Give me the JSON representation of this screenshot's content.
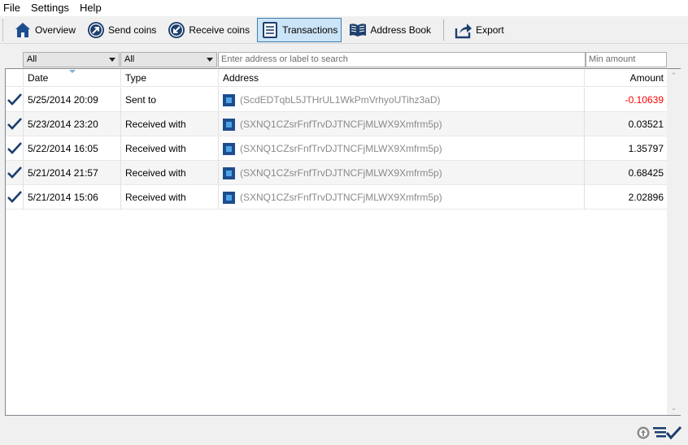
{
  "menu": [
    "File",
    "Settings",
    "Help"
  ],
  "toolbar": {
    "overview": "Overview",
    "send": "Send coins",
    "receive": "Receive coins",
    "transactions": "Transactions",
    "address_book": "Address Book",
    "export": "Export"
  },
  "filters": {
    "date_value": "All",
    "type_value": "All",
    "search_placeholder": "Enter address or label to search",
    "min_placeholder": "Min amount"
  },
  "table": {
    "headers": {
      "date": "Date",
      "type": "Type",
      "address": "Address",
      "amount": "Amount"
    },
    "rows": [
      {
        "date": "5/25/2014 20:09",
        "type": "Sent to",
        "address": "(ScdEDTqbL5JTHrUL1WkPmVrhyoUTihz3aD)",
        "amount": "-0.10639",
        "negative": true
      },
      {
        "date": "5/23/2014 23:20",
        "type": "Received with",
        "address": "(SXNQ1CZsrFnfTrvDJTNCFjMLWX9Xmfrm5p)",
        "amount": "0.03521",
        "negative": false
      },
      {
        "date": "5/22/2014 16:05",
        "type": "Received with",
        "address": "(SXNQ1CZsrFnfTrvDJTNCFjMLWX9Xmfrm5p)",
        "amount": "1.35797",
        "negative": false
      },
      {
        "date": "5/21/2014 21:57",
        "type": "Received with",
        "address": "(SXNQ1CZsrFnfTrvDJTNCFjMLWX9Xmfrm5p)",
        "amount": "0.68425",
        "negative": false
      },
      {
        "date": "5/21/2014 15:06",
        "type": "Received with",
        "address": "(SXNQ1CZsrFnfTrvDJTNCFjMLWX9Xmfrm5p)",
        "amount": "2.02896",
        "negative": false
      }
    ]
  },
  "colors": {
    "negative_amount": "#ff0000",
    "active_tab_bg": "#cce4f7",
    "check": "#1a3d6e"
  }
}
